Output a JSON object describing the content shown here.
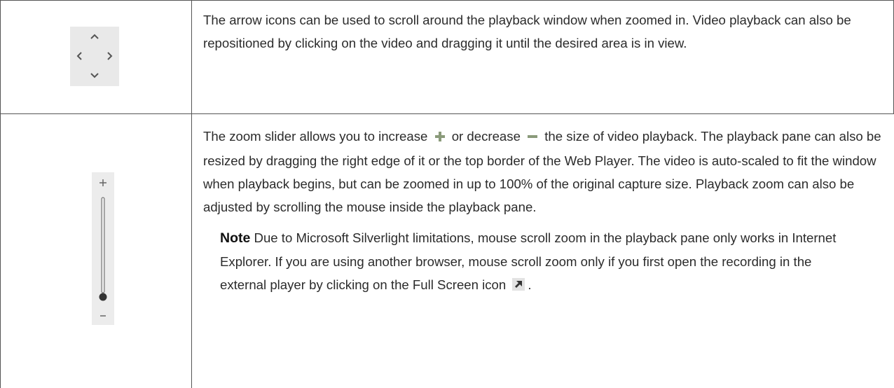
{
  "rows": [
    {
      "icon": "directional-arrows-icon",
      "text": "The arrow icons can be used to scroll around the playback window when zoomed in. Video playback can also be repositioned by clicking on the video and dragging it until the desired area is in view."
    },
    {
      "icon": "zoom-slider-icon",
      "text_part1": "The zoom slider allows you to increase",
      "text_part2": "or decrease",
      "text_part3": "the size of video playback. The playback pane can also be resized by dragging the right edge of it or the top border of the Web Player. The video is auto-scaled to fit the window when playback begins, but can be zoomed in up to 100% of the original capture size. Playback zoom can also be adjusted by scrolling the mouse inside the playback pane.",
      "note_label": "Note",
      "note_text_part1": "Due to Microsoft Silverlight limitations, mouse scroll zoom in the playback pane only works in Internet Explorer. If you are using another browser, mouse scroll zoom only if you first open the recording in the external player by clicking on the Full Screen icon",
      "note_text_part2": "."
    }
  ],
  "zoom_slider": {
    "plus": "+",
    "minus": "−",
    "level": 0.0
  },
  "colors": {
    "icon_green": "#8a9a7a",
    "border": "#555555",
    "icon_bg": "#e9e9e9"
  }
}
